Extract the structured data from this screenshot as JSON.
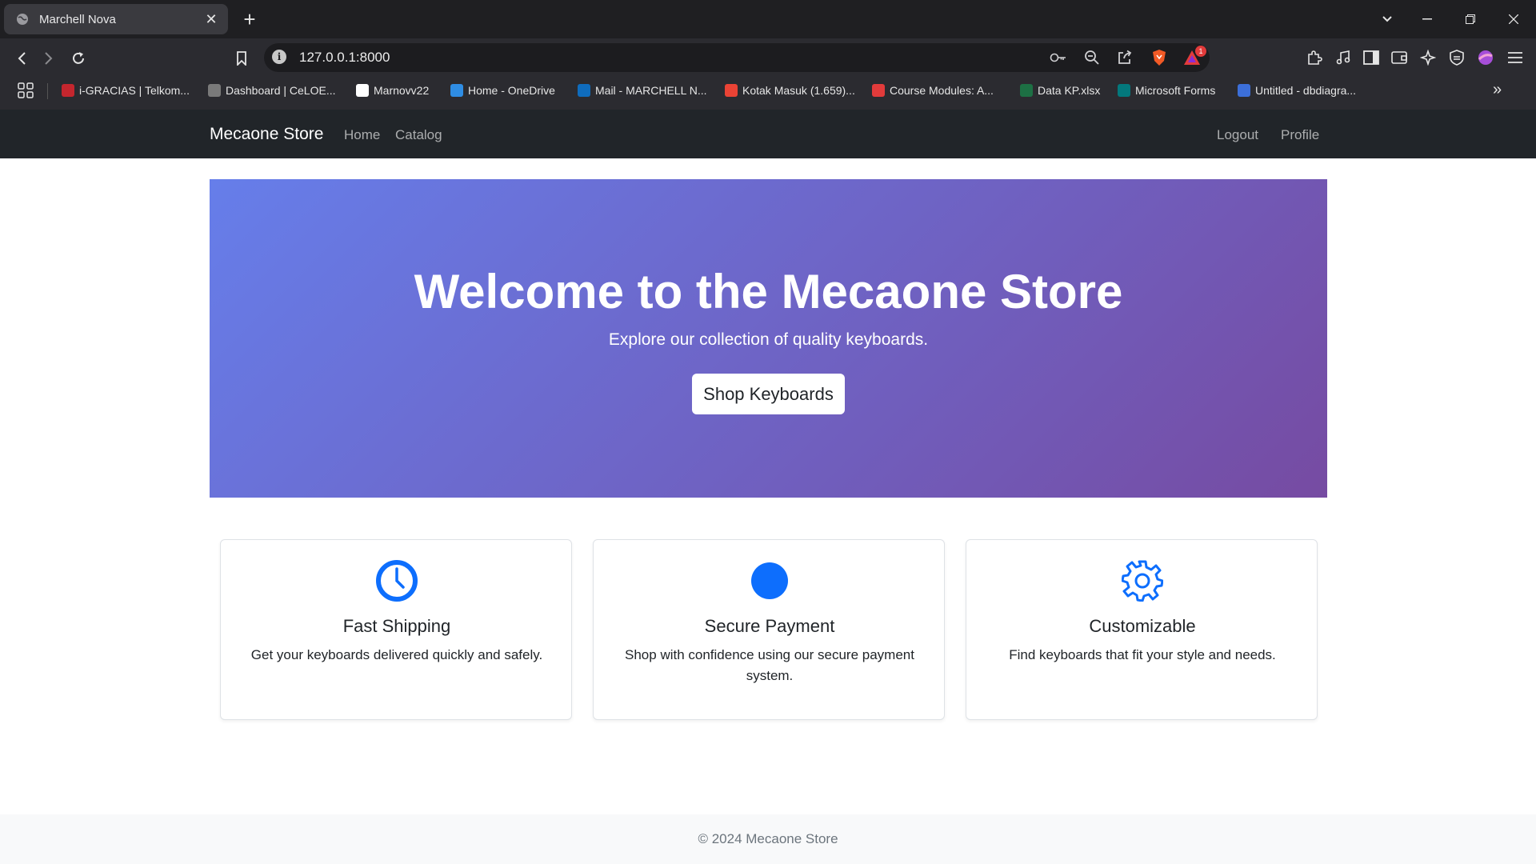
{
  "browser": {
    "tab_title": "Marchell Nova",
    "url": "127.0.0.1:8000",
    "notification_count": "1",
    "bookmarks": [
      {
        "label": "i-GRACIAS | Telkom...",
        "color": "#c4262e"
      },
      {
        "label": "Dashboard | CeLOE...",
        "color": "#7a7a7a"
      },
      {
        "label": "Marnovv22",
        "color": "#ffffff"
      },
      {
        "label": "Home - OneDrive",
        "color": "#2f8de4"
      },
      {
        "label": "Mail - MARCHELL N...",
        "color": "#0f6cbd"
      },
      {
        "label": "Kotak Masuk (1.659)...",
        "color": "#ea4335"
      },
      {
        "label": "Course Modules: A...",
        "color": "#e23b3b"
      },
      {
        "label": "Data KP.xlsx",
        "color": "#1d7044"
      },
      {
        "label": "Microsoft Forms",
        "color": "#03787c"
      },
      {
        "label": "Untitled - dbdiagra...",
        "color": "#3c6fd9"
      }
    ]
  },
  "navbar": {
    "brand": "Mecaone Store",
    "links": [
      "Home",
      "Catalog"
    ],
    "right_links": [
      "Logout",
      "Profile"
    ]
  },
  "hero": {
    "title": "Welcome to the Mecaone Store",
    "subtitle": "Explore our collection of quality keyboards.",
    "button": "Shop Keyboards"
  },
  "features": [
    {
      "icon": "clock-icon",
      "title": "Fast Shipping",
      "text": "Get your keyboards delivered quickly and safely."
    },
    {
      "icon": "shield-icon",
      "title": "Secure Payment",
      "text": "Shop with confidence using our secure payment system."
    },
    {
      "icon": "gear-icon",
      "title": "Customizable",
      "text": "Find keyboards that fit your style and needs."
    }
  ],
  "footer": {
    "copyright": "© 2024 Mecaone Store"
  },
  "colors": {
    "accent": "#0d6efd",
    "navbar": "#212529",
    "hero_start": "#667eea",
    "hero_end": "#764ba2"
  }
}
